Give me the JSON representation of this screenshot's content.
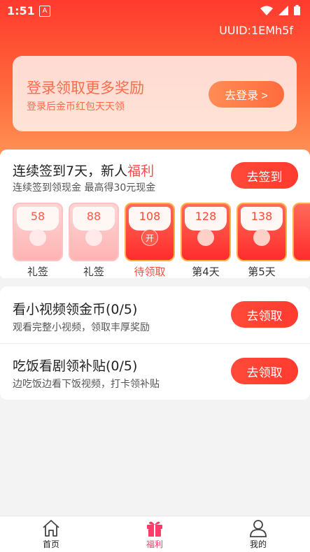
{
  "status_bar": {
    "time": "1:51",
    "badge": "A"
  },
  "header": {
    "uuid": "UUID:1EMh5f"
  },
  "login_card": {
    "title": "登录领取更多奖励",
    "subtitle": "登录后金币红包天天领",
    "button_label": "去登录 >"
  },
  "signin": {
    "title_prefix": "连续签到7天，新人",
    "title_highlight": "福利",
    "subtitle": "连续签到领现金 最高得30元现金",
    "button_label": "去签到",
    "days": [
      {
        "amount": "58",
        "label": "礼签"
      },
      {
        "amount": "88",
        "label": "礼签"
      },
      {
        "amount": "108",
        "label": "待领取",
        "seal": "开"
      },
      {
        "amount": "128",
        "label": "第4天"
      },
      {
        "amount": "138",
        "label": "第5天"
      }
    ]
  },
  "tasks": [
    {
      "title": "看小视频领金币(0/5)",
      "subtitle": "观看完整小视频，领取丰厚奖励",
      "button_label": "去领取"
    },
    {
      "title": "吃饭看剧领补贴(0/5)",
      "subtitle": "边吃饭边看下饭视频，打卡领补贴",
      "button_label": "去领取"
    }
  ],
  "tabbar": {
    "items": [
      {
        "label": "首页",
        "icon": "home-icon"
      },
      {
        "label": "福利",
        "icon": "gift-icon"
      },
      {
        "label": "我的",
        "icon": "user-icon"
      }
    ],
    "active_color": "#ff3b6b"
  },
  "colors": {
    "accent": "#ff3b2e",
    "highlight": "#ff4b4b"
  }
}
